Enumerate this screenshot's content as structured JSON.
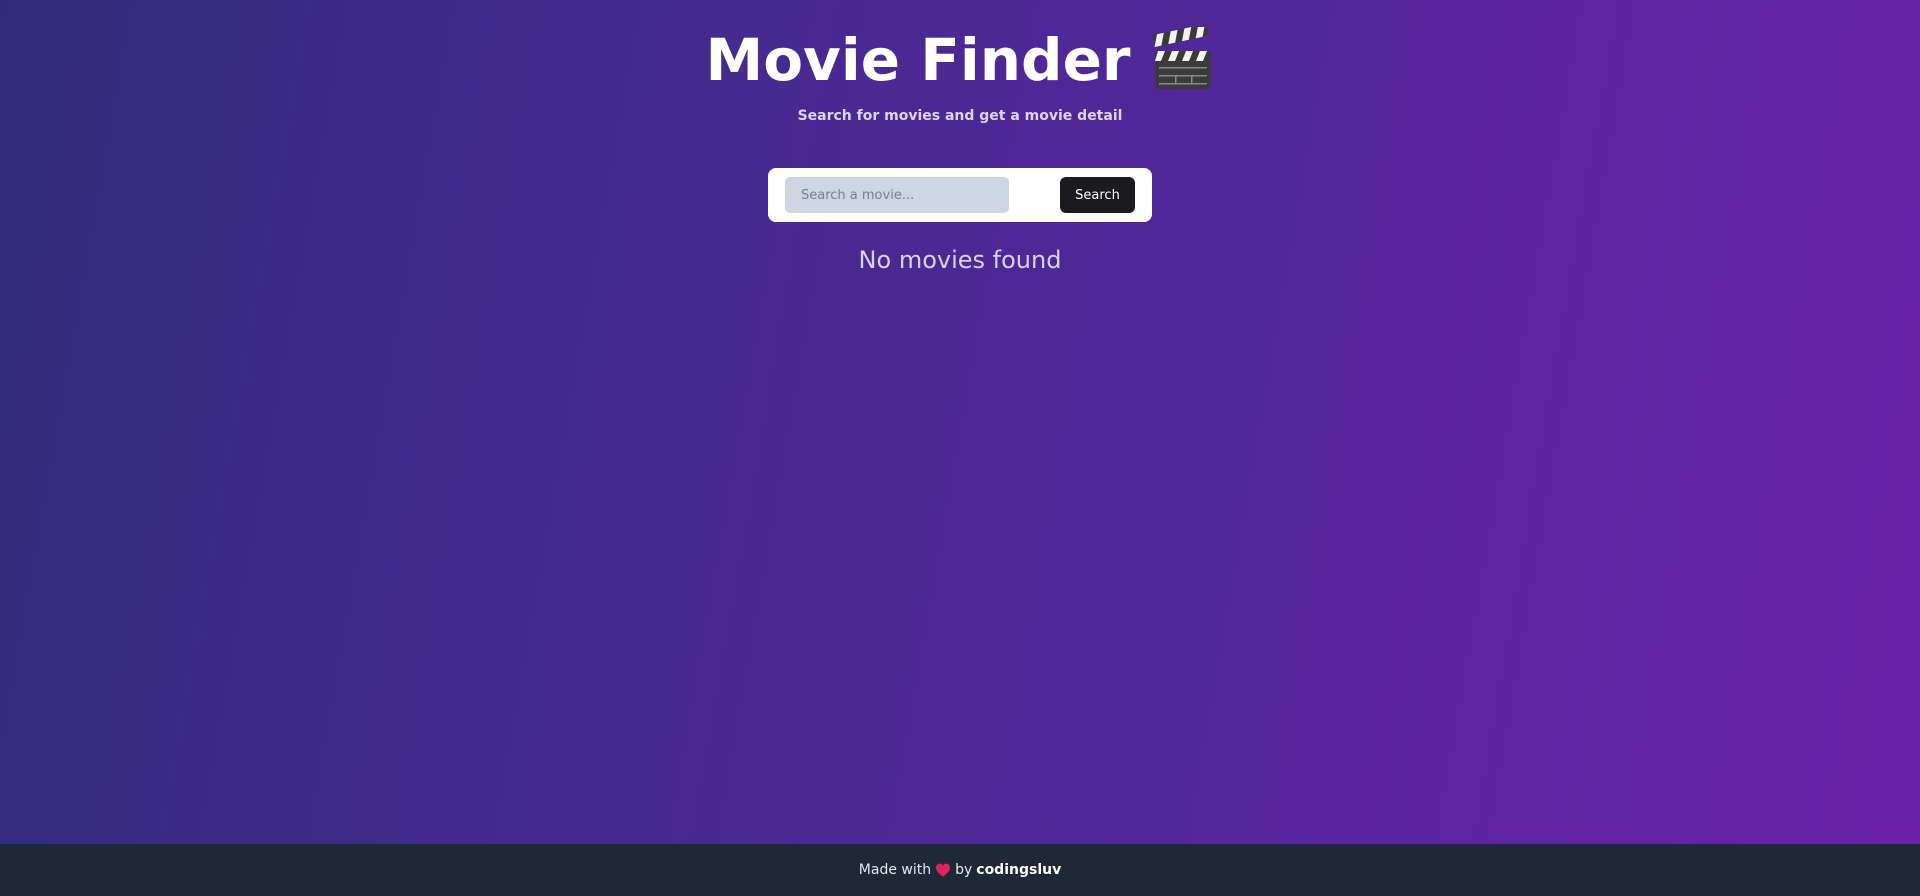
{
  "header": {
    "title": "Movie Finder",
    "title_icon": "clapperboard-icon",
    "subtitle": "Search for movies and get a movie detail"
  },
  "search": {
    "placeholder": "Search a movie...",
    "value": "",
    "button_label": "Search"
  },
  "results": {
    "empty_message": "No movies found"
  },
  "footer": {
    "made_with": "Made with",
    "heart_icon": "heart-icon",
    "by": "by",
    "author": "codingsluv"
  },
  "colors": {
    "background_start": "#312b7e",
    "background_end": "#6a22aa",
    "footer_bg": "#1f2837",
    "button_bg": "#1b1b1f",
    "input_bg": "#cdd5e0",
    "heart": "#e0245e"
  }
}
